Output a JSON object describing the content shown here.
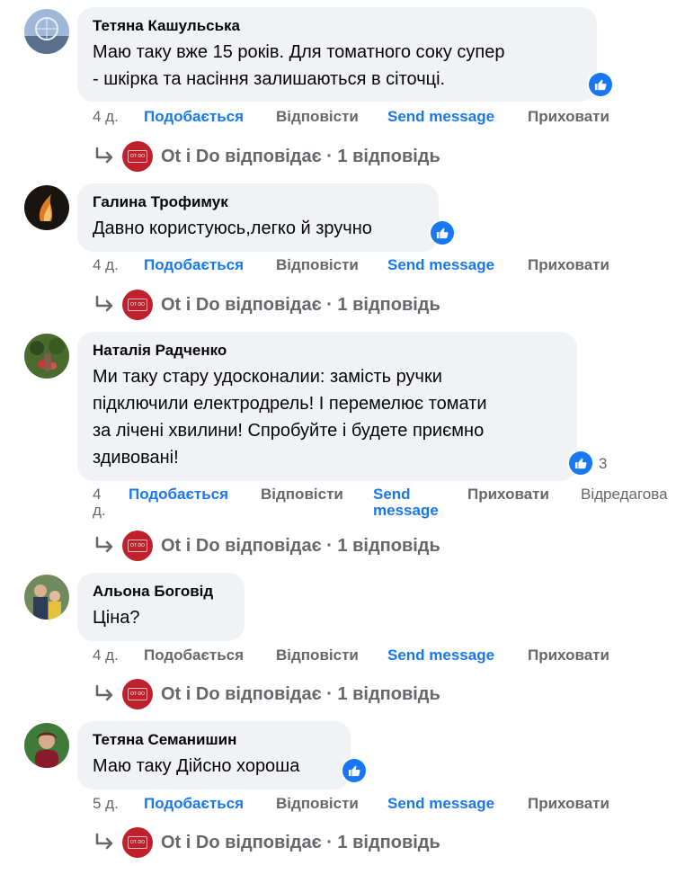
{
  "common": {
    "like_label": "Подобається",
    "reply_label": "Відповісти",
    "send_label": "Send message",
    "hide_label": "Приховати",
    "reply_thread_text": "Ot i Do відповідає · 1 відповідь"
  },
  "comments": [
    {
      "author": "Тетяна Кашульська",
      "text_lines": [
        "Маю таку вже 15 років. Для томатного соку супер",
        "- шкірка та насіння залишаються в сіточці."
      ],
      "time": "4 д."
    },
    {
      "author": "Галина Трофимук",
      "text_lines": [
        "Давно користуюсь,легко й зручно"
      ],
      "time": "4 д."
    },
    {
      "author": "Наталія Радченко",
      "text_lines": [
        "Ми таку стару удосконалии: замість ручки",
        "підключили електродрель! І перемелює томати",
        "за лічені хвилини! Спробуйте і будете приємно",
        "здивовані!"
      ],
      "time_line1": "4",
      "time_line2": "д.",
      "like_count": "3",
      "send_line1": "Send",
      "send_line2": "message",
      "edited_label": "Відредагова"
    },
    {
      "author": "Альона Боговід",
      "text_lines": [
        "Ціна?"
      ],
      "time": "4 д."
    },
    {
      "author": "Тетяна Семанишин",
      "text_lines": [
        "Маю таку Дійсно хороша"
      ],
      "time": "5 д."
    }
  ],
  "colors": {
    "bubble_bg": "#f0f2f5",
    "link_blue": "#1877f2",
    "secondary_text": "#65676b",
    "page_avatar_red": "#c0202b"
  }
}
